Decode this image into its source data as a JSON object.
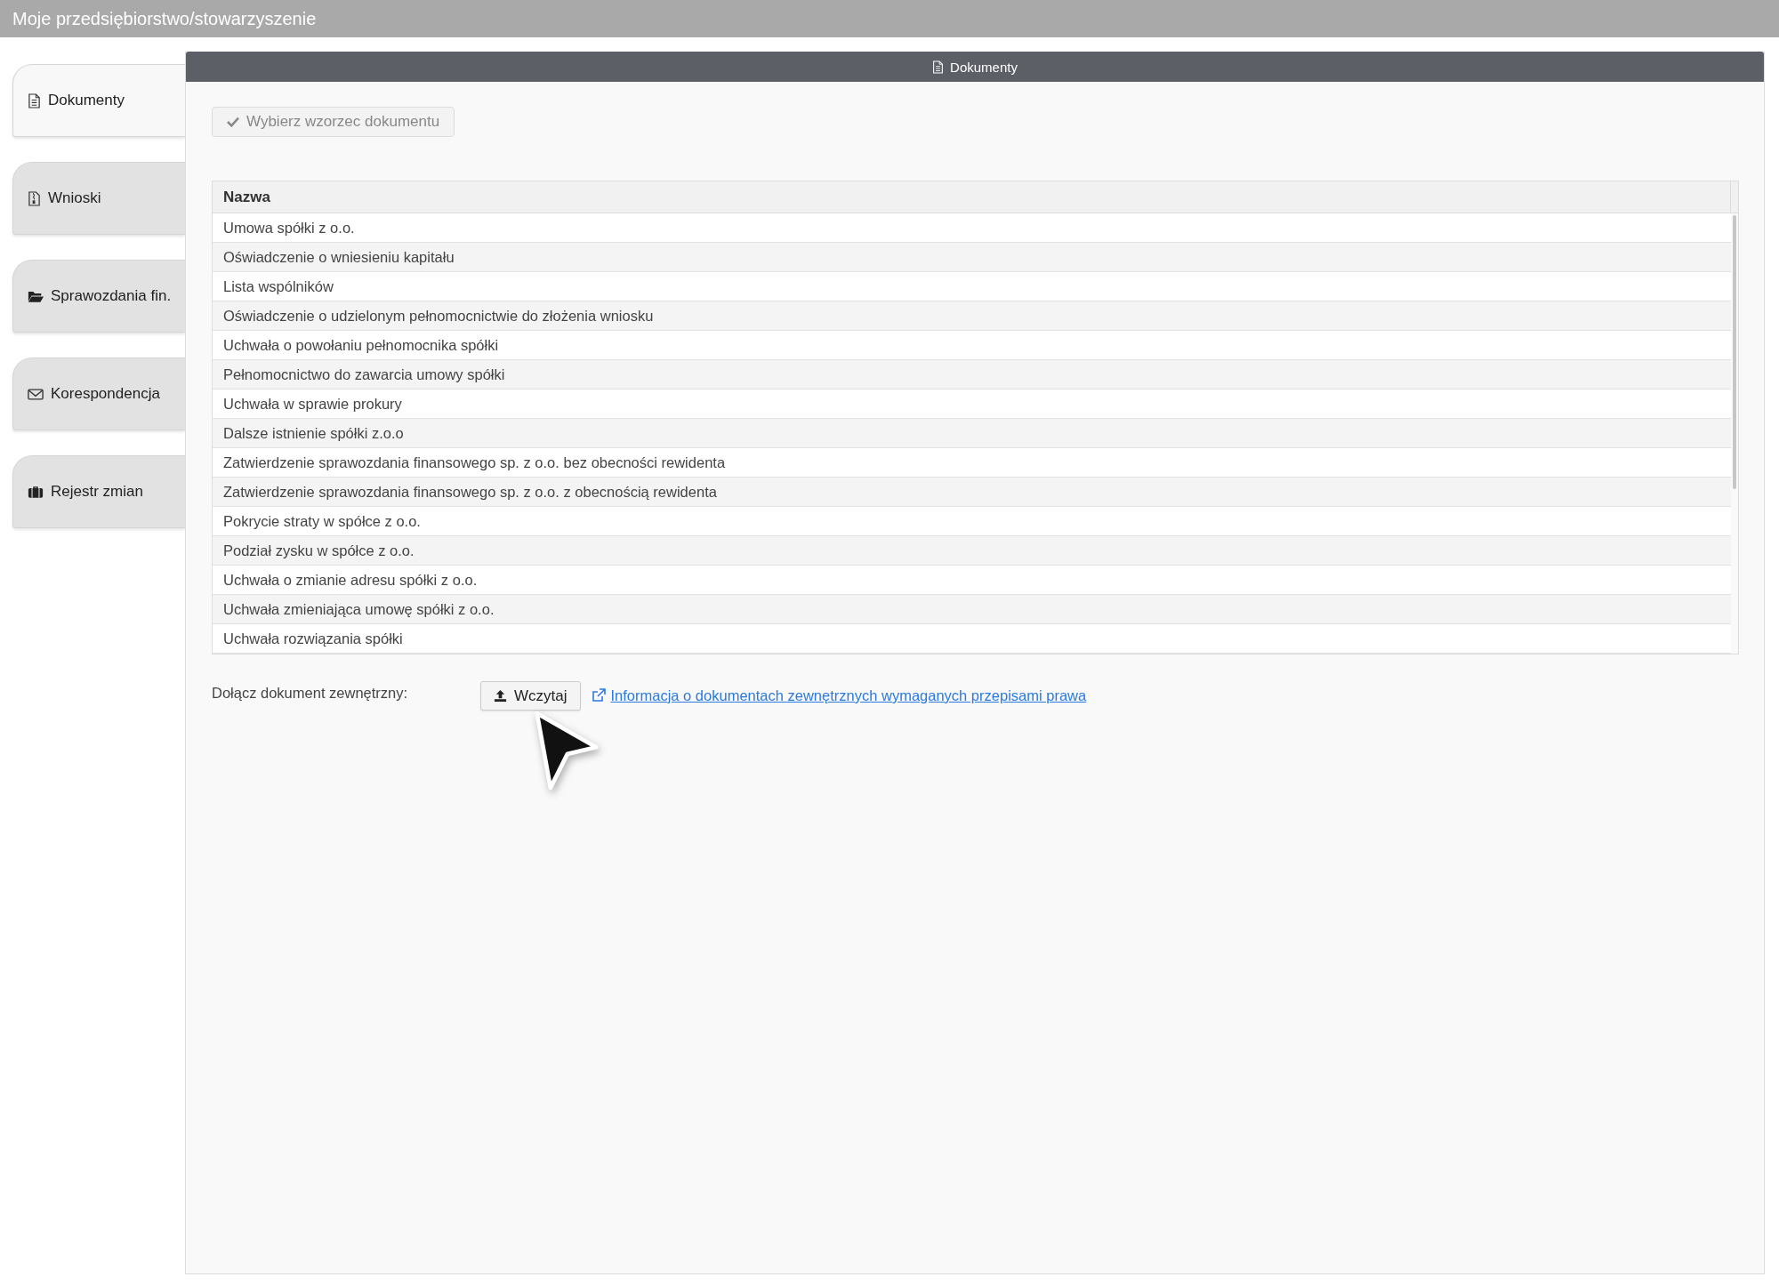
{
  "window": {
    "title": "Moje przedsiębiorstwo/stowarzyszenie"
  },
  "sidebar": {
    "items": [
      {
        "label": "Dokumenty",
        "selected": true
      },
      {
        "label": "Wnioski",
        "selected": false
      },
      {
        "label": "Sprawozdania fin.",
        "selected": false
      },
      {
        "label": "Korespondencja",
        "selected": false
      },
      {
        "label": "Rejestr zmian",
        "selected": false
      }
    ]
  },
  "panel": {
    "title": "Dokumenty",
    "template_button": "Wybierz wzorzec dokumentu",
    "table": {
      "columns": [
        "Nazwa"
      ],
      "rows": [
        "Umowa spółki z o.o.",
        "Oświadczenie o wniesieniu kapitału",
        "Lista wspólników",
        "Oświadczenie o udzielonym pełnomocnictwie do złożenia wniosku",
        "Uchwała o powołaniu pełnomocnika spółki",
        "Pełnomocnictwo do zawarcia umowy spółki",
        "Uchwała w sprawie prokury",
        "Dalsze istnienie spółki z.o.o",
        "Zatwierdzenie sprawozdania finansowego sp. z o.o. bez obecności rewidenta",
        "Zatwierdzenie sprawozdania finansowego sp. z o.o. z obecnością rewidenta",
        "Pokrycie straty w spółce z o.o.",
        "Podział zysku w spółce z o.o.",
        "Uchwała o zmianie adresu spółki z o.o.",
        "Uchwała zmieniająca umowę spółki z o.o.",
        "Uchwała rozwiązania spółki"
      ]
    },
    "attach": {
      "label": "Dołącz dokument zewnętrzny:",
      "button": "Wczytaj",
      "link": "Informacja o dokumentach zewnętrznych wymaganych przepisami prawa"
    }
  }
}
